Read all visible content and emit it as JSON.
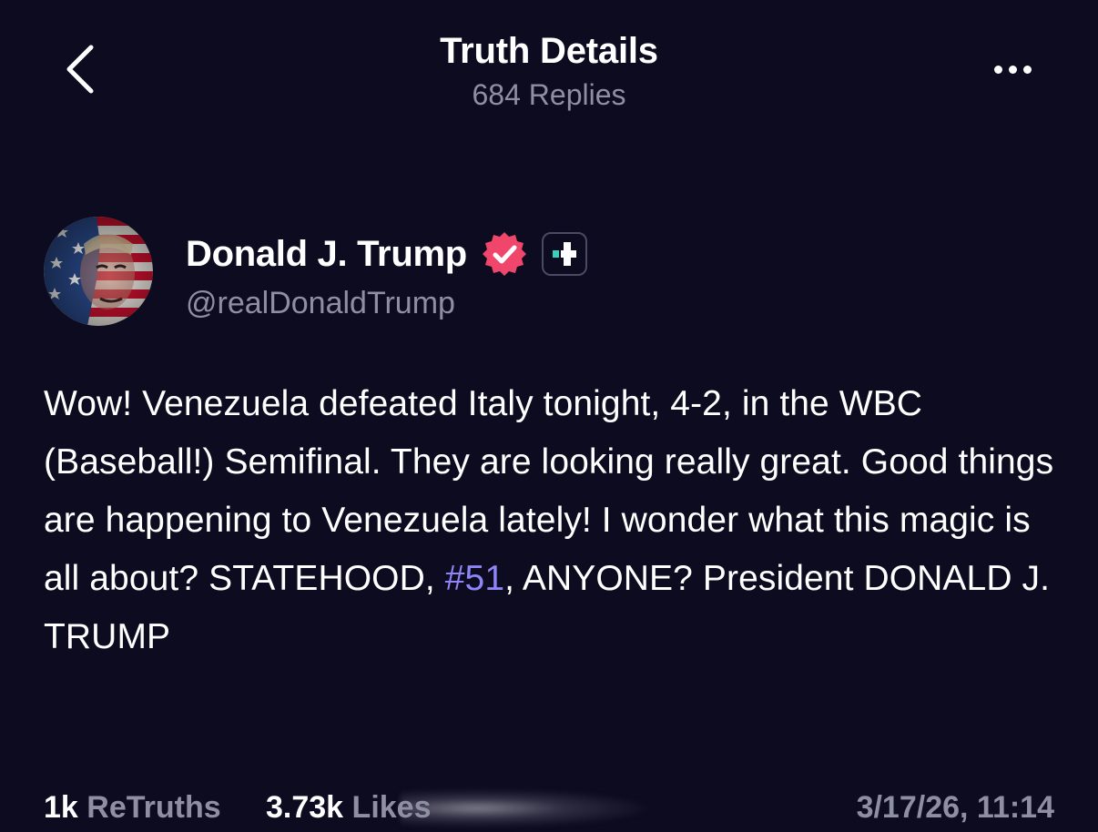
{
  "header": {
    "title": "Truth Details",
    "subtitle": "684 Replies",
    "back_icon": "chevron-left-icon",
    "more_icon": "more-horizontal-icon"
  },
  "author": {
    "display_name": "Donald J. Trump",
    "handle": "@realDonaldTrump",
    "verified_icon": "verified-badge-icon",
    "verified_color": "#f0466b",
    "plus_badge_icon": "plus-subscription-icon",
    "avatar": "avatar-flag-portrait"
  },
  "post": {
    "text_before_tag": "Wow! Venezuela defeated Italy tonight, 4-2, in the WBC (Baseball!) Semifinal. They are looking really great. Good things are happening to Venezuela lately! I wonder what this magic is all about? STATEHOOD, ",
    "hashtag": "#51",
    "text_after_tag": ", ANYONE? President DONALD J. TRUMP"
  },
  "stats": {
    "retruths_count": "1k",
    "retruths_label": "ReTruths",
    "likes_count": "3.73k",
    "likes_label": "Likes",
    "timestamp": "3/17/26, 11:14"
  },
  "colors": {
    "background": "#0d0b1f",
    "text_primary": "#ffffff",
    "text_secondary": "#8f8fa3",
    "hashtag": "#8e85f7"
  }
}
